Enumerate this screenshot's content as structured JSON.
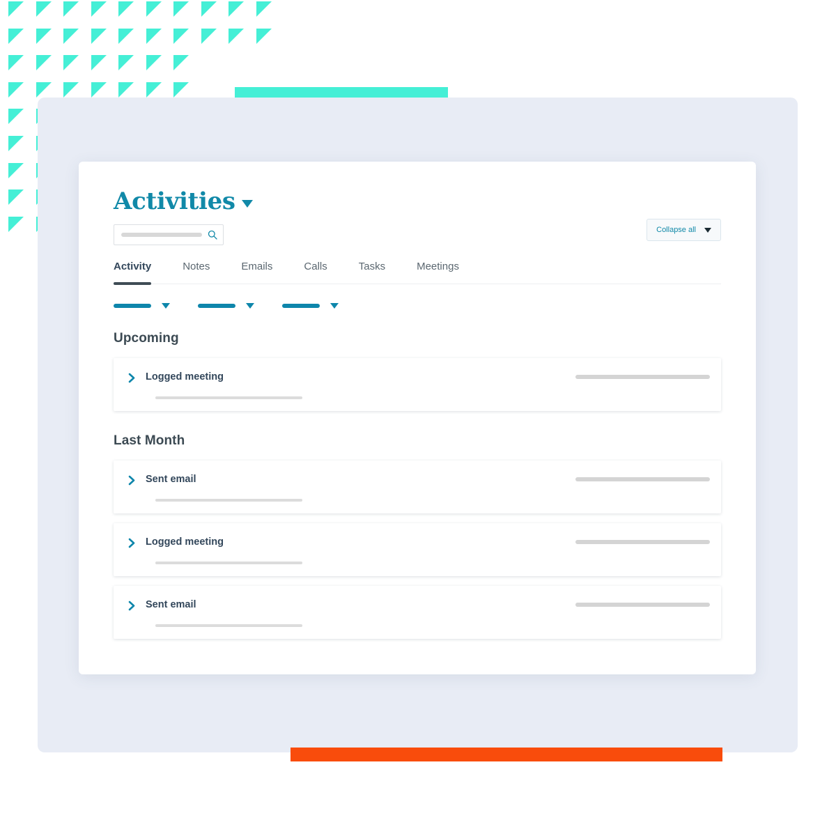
{
  "header": {
    "title": "Activities",
    "title_caret_icon": "chevron-down-icon"
  },
  "search": {
    "placeholder": "",
    "value": "",
    "icon": "search-icon"
  },
  "toolbar": {
    "collapse_all_label": "Collapse all",
    "collapse_all_caret_icon": "chevron-down-icon"
  },
  "tabs": [
    {
      "label": "Activity",
      "active": true
    },
    {
      "label": "Notes",
      "active": false
    },
    {
      "label": "Emails",
      "active": false
    },
    {
      "label": "Calls",
      "active": false
    },
    {
      "label": "Tasks",
      "active": false
    },
    {
      "label": "Meetings",
      "active": false
    }
  ],
  "filters": [
    {
      "name": "filter-one",
      "caret_icon": "chevron-down-icon"
    },
    {
      "name": "filter-two",
      "caret_icon": "chevron-down-icon"
    },
    {
      "name": "filter-three",
      "caret_icon": "chevron-down-icon"
    }
  ],
  "sections": [
    {
      "heading": "Upcoming",
      "items": [
        {
          "label": "Logged meeting",
          "expand_icon": "chevron-right-icon"
        }
      ]
    },
    {
      "heading": "Last Month",
      "items": [
        {
          "label": "Sent email",
          "expand_icon": "chevron-right-icon"
        },
        {
          "label": "Logged meeting",
          "expand_icon": "chevron-right-icon"
        },
        {
          "label": "Sent email",
          "expand_icon": "chevron-right-icon"
        }
      ]
    }
  ],
  "decor": {
    "triangle_color": "#45efd6",
    "teal_bar_color": "#45efd6",
    "orange_bar_color": "#f94c0c",
    "backdrop_color": "#e8ecf5",
    "accent_teal": "#1189a8"
  }
}
